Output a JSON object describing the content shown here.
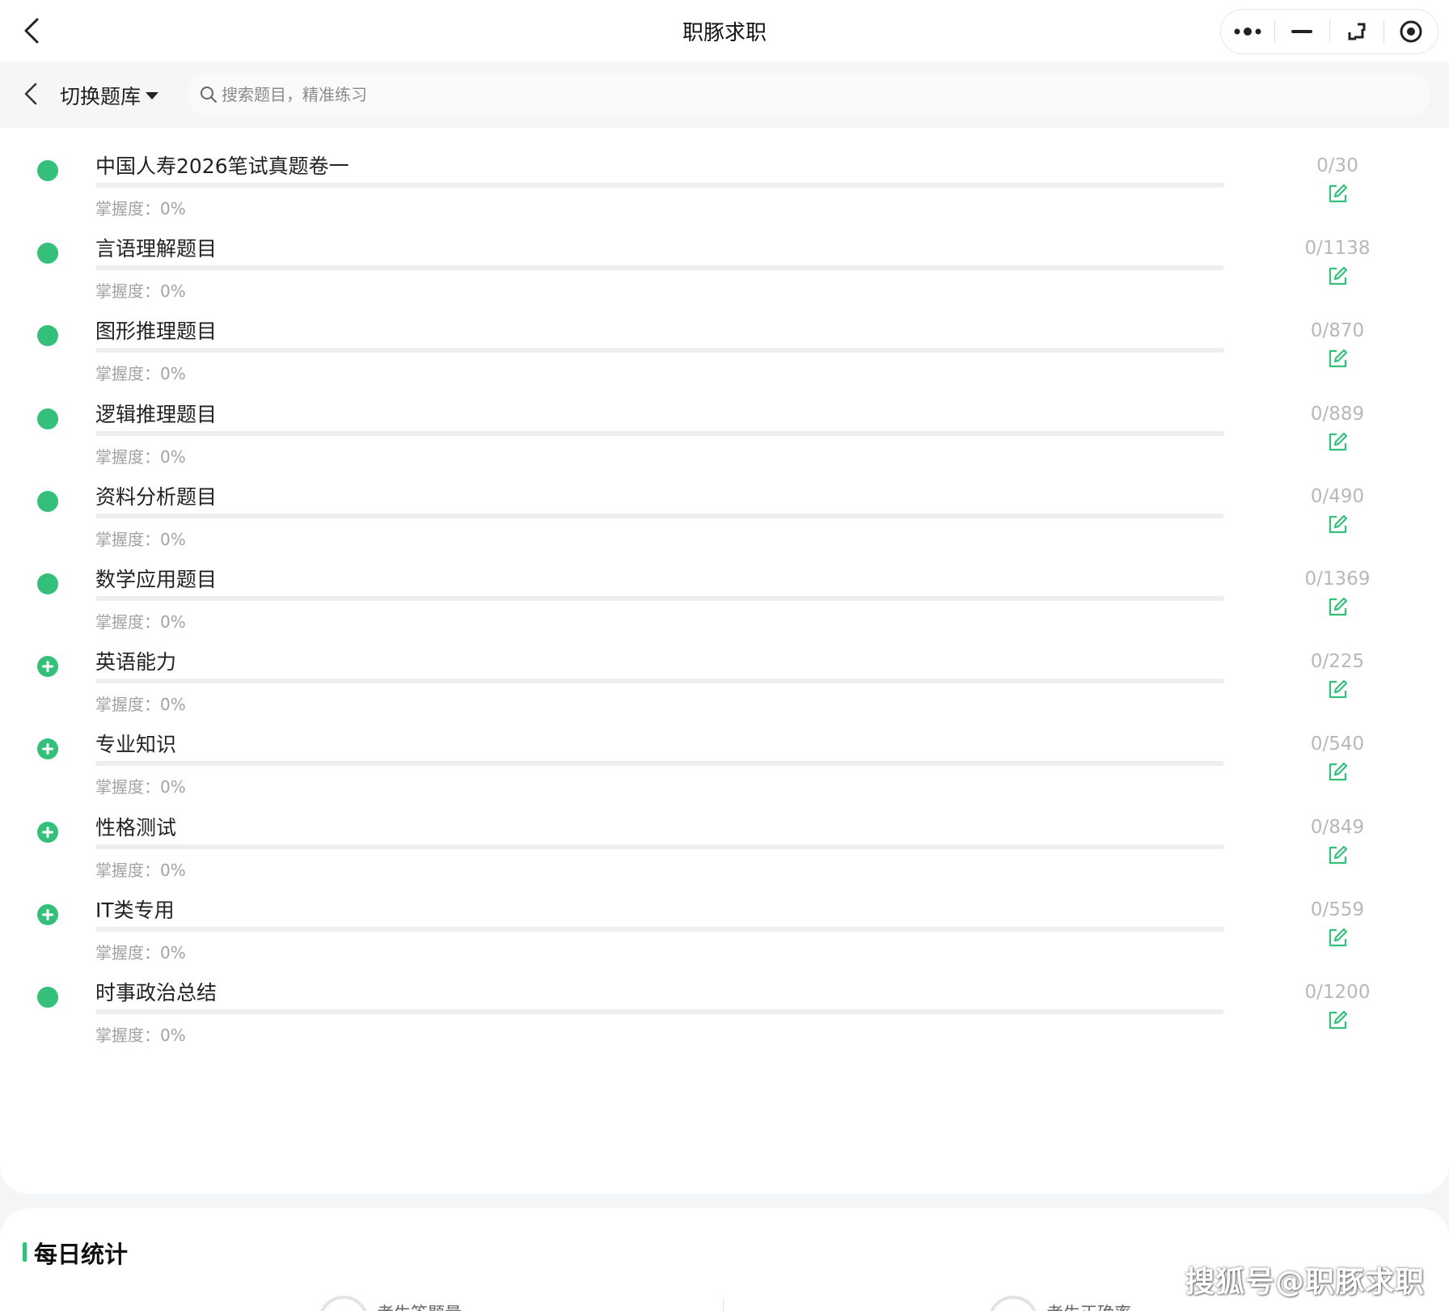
{
  "window": {
    "title": "职豚求职"
  },
  "search_bar": {
    "switch_label": "切换题库",
    "placeholder": "搜索题目，精准练习"
  },
  "colors": {
    "accent": "#35c07a",
    "count_text": "#b8b8b8",
    "mastery_text": "#a3a3a3"
  },
  "categories": [
    {
      "name": "中国人寿2026笔试真题卷一",
      "mastery": "掌握度：0%",
      "mastery_fraction": 0,
      "count": "0/30",
      "marker": "dot"
    },
    {
      "name": "言语理解题目",
      "mastery": "掌握度：0%",
      "mastery_fraction": 0,
      "count": "0/1138",
      "marker": "dot"
    },
    {
      "name": "图形推理题目",
      "mastery": "掌握度：0%",
      "mastery_fraction": 0,
      "count": "0/870",
      "marker": "dot"
    },
    {
      "name": "逻辑推理题目",
      "mastery": "掌握度：0%",
      "mastery_fraction": 0,
      "count": "0/889",
      "marker": "dot"
    },
    {
      "name": "资料分析题目",
      "mastery": "掌握度：0%",
      "mastery_fraction": 0,
      "count": "0/490",
      "marker": "dot"
    },
    {
      "name": "数学应用题目",
      "mastery": "掌握度：0%",
      "mastery_fraction": 0,
      "count": "0/1369",
      "marker": "dot"
    },
    {
      "name": "英语能力",
      "mastery": "掌握度：0%",
      "mastery_fraction": 0,
      "count": "0/225",
      "marker": "plus"
    },
    {
      "name": "专业知识",
      "mastery": "掌握度：0%",
      "mastery_fraction": 0,
      "count": "0/540",
      "marker": "plus"
    },
    {
      "name": "性格测试",
      "mastery": "掌握度：0%",
      "mastery_fraction": 0,
      "count": "0/849",
      "marker": "plus"
    },
    {
      "name": "IT类专用",
      "mastery": "掌握度：0%",
      "mastery_fraction": 0,
      "count": "0/559",
      "marker": "plus"
    },
    {
      "name": "时事政治总结",
      "mastery": "掌握度：0%",
      "mastery_fraction": 0,
      "count": "0/1200",
      "marker": "dot"
    }
  ],
  "daily_stats": {
    "title": "每日统计",
    "items": [
      {
        "label": "考生答题量"
      },
      {
        "label": "考生正确率"
      }
    ]
  },
  "watermark": "搜狐号@职豚求职"
}
